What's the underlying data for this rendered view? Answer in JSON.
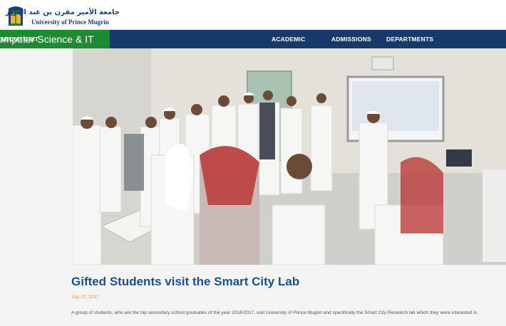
{
  "header": {
    "logo_arabic": "جامعة الأمير مقرن بن عبد العزيز",
    "logo_english": "University of Prince Mugrin",
    "logo_icon": "palm-tree-emblem-icon"
  },
  "nav": {
    "brand": "omputer Science & IT",
    "items": [
      {
        "label": "ABOUT CSIT"
      },
      {
        "label": "ACADEMIC"
      },
      {
        "label": "ADMISSIONS"
      },
      {
        "label": "DEPARTMENTS"
      }
    ]
  },
  "article": {
    "title": "Gifted Students visit the Smart City Lab",
    "date": "July 27, 2017",
    "body": "A group of students, who are the top secondary school graduates of the year 2016/2017, visit University of Prince Mugrin and specifically the Smart City Research lab which they were interested in."
  },
  "colors": {
    "nav_background": "#163b6b",
    "brand_background": "#1e8a34",
    "title_color": "#1c4f86",
    "date_color": "#d79a2a"
  }
}
